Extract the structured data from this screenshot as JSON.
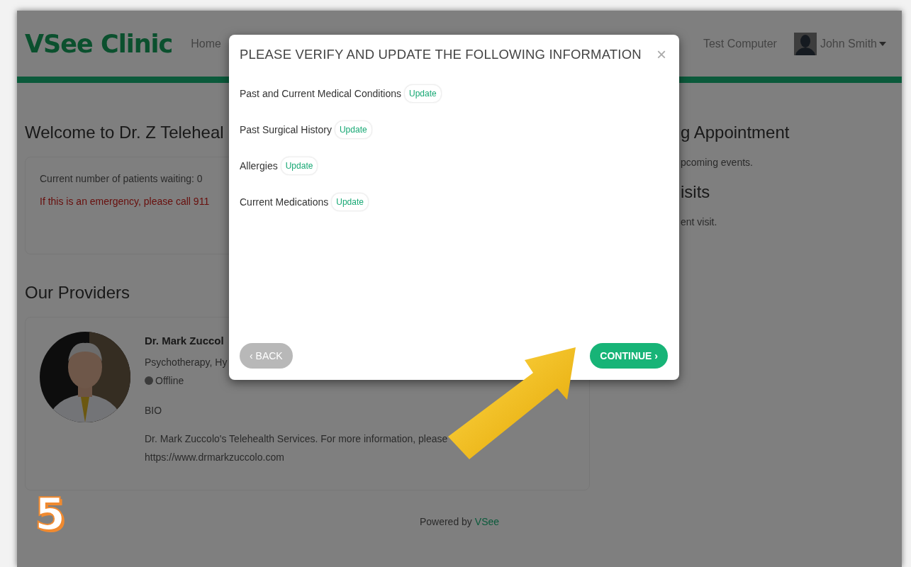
{
  "header": {
    "logo": "VSee Clinic",
    "nav": [
      {
        "label": "Home"
      }
    ],
    "right_links": [
      {
        "label": "Test Computer"
      }
    ],
    "user": {
      "name": "John Smith"
    }
  },
  "welcome": {
    "title": "Welcome to Dr. Z Teleheal",
    "waiting": "Current number of patients waiting: 0",
    "emergency": "If this is an emergency, please call 911"
  },
  "providers": {
    "title": "Our Providers",
    "items": [
      {
        "name": "Dr. Mark Zuccol",
        "specialty": "Psychotherapy, Hy",
        "status": "Offline",
        "online": false,
        "bio_label": "BIO",
        "bio": "Dr. Mark Zuccolo's Telehealth Services. For more information, please",
        "bio_link": "https://www.drmarkzuccolo.com"
      }
    ]
  },
  "sidebar": [
    {
      "kind": "heading",
      "text": "g Appointment"
    },
    {
      "kind": "text",
      "text": "pcoming events."
    },
    {
      "kind": "heading",
      "text": "isits"
    },
    {
      "kind": "text",
      "text": "ent visit."
    }
  ],
  "footer": {
    "text": "Powered by",
    "brand": "VSee"
  },
  "modal": {
    "title": "PLEASE VERIFY AND UPDATE THE FOLLOWING INFORMATION",
    "close": "×",
    "items": [
      {
        "label": "Past and Current Medical Conditions",
        "action": "Update"
      },
      {
        "label": "Past Surgical History",
        "action": "Update"
      },
      {
        "label": "Allergies",
        "action": "Update"
      },
      {
        "label": "Current Medications",
        "action": "Update"
      }
    ],
    "back": "‹ BACK",
    "continue": "CONTINUE ›"
  },
  "annotation": {
    "step": "5"
  }
}
